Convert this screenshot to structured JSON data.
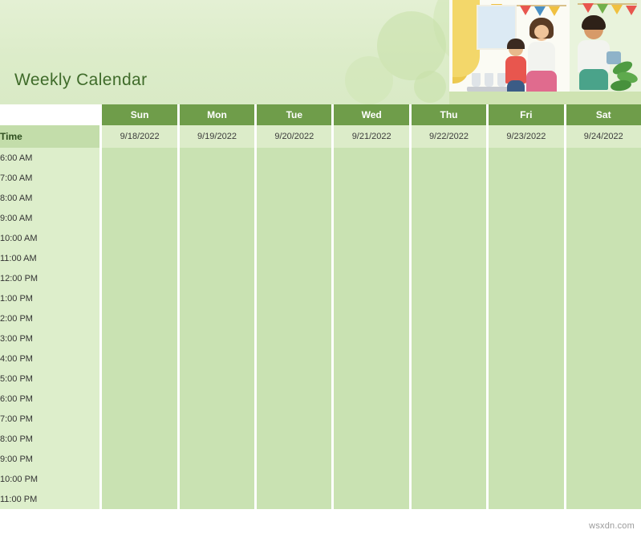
{
  "banner": {
    "title": "Weekly Calendar",
    "illustration_name": "family-party-illustration"
  },
  "table": {
    "time_header": "Time",
    "day_headers": [
      "Sun",
      "Mon",
      "Tue",
      "Wed",
      "Thu",
      "Fri",
      "Sat"
    ],
    "date_headers": [
      "9/18/2022",
      "9/19/2022",
      "9/20/2022",
      "9/21/2022",
      "9/22/2022",
      "9/23/2022",
      "9/24/2022"
    ],
    "time_slots": [
      "6:00 AM",
      "7:00 AM",
      "8:00 AM",
      "9:00 AM",
      "10:00 AM",
      "11:00 AM",
      "12:00 PM",
      "1:00 PM",
      "2:00 PM",
      "3:00 PM",
      "4:00 PM",
      "5:00 PM",
      "6:00 PM",
      "7:00 PM",
      "8:00 PM",
      "9:00 PM",
      "10:00 PM",
      "11:00 PM"
    ]
  },
  "watermark": "wsxdn.com",
  "colors": {
    "header_green": "#6f9d4a",
    "time_header_green": "#c3ddaa",
    "date_header_green": "#dcecc9",
    "slot_green": "#c9e2b2",
    "time_cell_green": "#ddeecb",
    "title_green": "#3f6b2a"
  }
}
